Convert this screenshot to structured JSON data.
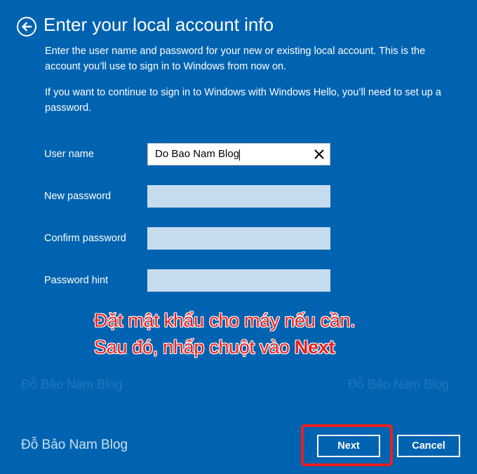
{
  "header": {
    "back_icon": "arrow-left-icon",
    "title": "Enter your local account info"
  },
  "description": {
    "paragraph1": "Enter the user name and password for your new or existing local account. This is the account you’ll use to sign in to Windows from now on.",
    "paragraph2": "If you want to continue to sign in to Windows with Windows Hello, you’ll need to set up a password."
  },
  "form": {
    "username_label": "User name",
    "username_value": "Do Bao Nam Blog",
    "new_password_label": "New password",
    "confirm_password_label": "Confirm password",
    "password_hint_label": "Password hint",
    "clear_icon": "close-icon"
  },
  "annotation": {
    "line1": "Đặt mật khẩu cho máy nếu cần.",
    "line2_prefix": "Sau đó, nhấp chuột vào ",
    "line2_bold": "Next"
  },
  "watermark": {
    "faint_left": "Đỗ Bảo Nam Blog",
    "faint_right": "Đỗ Bảo Nam Blog",
    "main": "Đỗ Bảo Nam Blog"
  },
  "buttons": {
    "next_label": "Next",
    "cancel_label": "Cancel"
  },
  "colors": {
    "background": "#0063b1",
    "annotation_red": "#e8201d",
    "field_inactive": "#c6dcee"
  }
}
